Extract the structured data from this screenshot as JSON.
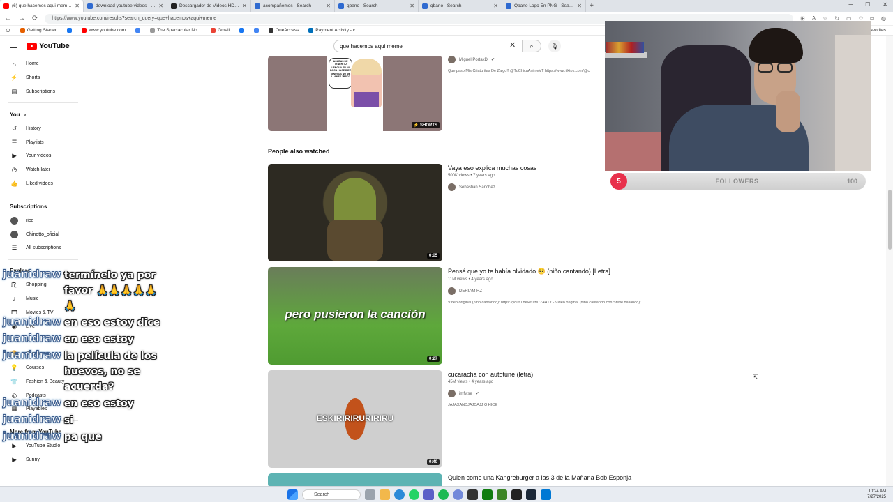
{
  "browser": {
    "tabs": [
      {
        "title": "(6) que hacemos aqui meme - Yo",
        "color": "#ff0000",
        "active": true
      },
      {
        "title": "download youtube videos - Search",
        "color": "#2f6ad0"
      },
      {
        "title": "Descargador de Videos HD de Yo",
        "color": "#222222"
      },
      {
        "title": "acompañemos - Search",
        "color": "#2f6ad0"
      },
      {
        "title": "qbano - Search",
        "color": "#2f6ad0"
      },
      {
        "title": "qbano - Search",
        "color": "#2f6ad0"
      },
      {
        "title": "Qbano Logo En PNG - Search Ima",
        "color": "#2f6ad0"
      }
    ],
    "new_tab": "+",
    "url": "https://www.youtube.com/results?search_query=que+hacemos+aqui+meme",
    "bookmarks": [
      {
        "label": "Getting Started",
        "color": "#e66000"
      },
      {
        "label": "",
        "color": "#1877f2"
      },
      {
        "label": "www.youtube.com",
        "color": "#ff0000"
      },
      {
        "label": "",
        "color": "#4285f4"
      },
      {
        "label": "The Spectacular No...",
        "color": "#999999"
      },
      {
        "label": "Gmail",
        "color": "#ea4335"
      },
      {
        "label": "",
        "color": "#1877f2"
      },
      {
        "label": "",
        "color": "#4285f4"
      },
      {
        "label": "OneAccess",
        "color": "#333333"
      },
      {
        "label": "Payment Activity - c...",
        "color": "#0070ba"
      }
    ],
    "favorites": "Favorites"
  },
  "youtube": {
    "logo": "YouTube",
    "search_query": "que hacemos aqui meme",
    "sidebar": {
      "main": [
        "Home",
        "Shorts",
        "Subscriptions"
      ],
      "you_label": "You",
      "you_items": [
        "History",
        "Playlists",
        "Your videos",
        "Watch later",
        "Liked videos"
      ],
      "subs_label": "Subscriptions",
      "subs_items": [
        "rice",
        "Chinotto_oficial",
        "All subscriptions"
      ],
      "explore_label": "Explore",
      "explore_items": [
        "Shopping",
        "Music",
        "Movies & TV",
        "Live",
        "News",
        "Sports",
        "Courses",
        "Fashion & Beauty",
        "Podcasts",
        "Playables"
      ],
      "more_label": "More from YouTube",
      "more_items": [
        "YouTube Studio",
        "Sunny"
      ]
    },
    "top_result": {
      "channel": "Miguel PortaxD",
      "desc": "Que paso Mis Criaturitas De Zaigo!! @TuChicaAnimeVT https://www.tiktok.com/@cl",
      "badge": "SHORTS",
      "panel_text": "ACABAS DE TENER TU LENGUA EN MI BOCA HACE DIEZ MINUTOS NO ME LLAMES \"BRO\""
    },
    "section_title": "People also watched",
    "videos": [
      {
        "title": "Vaya eso explica muchas cosas",
        "meta": "500K views • 7 years ago",
        "channel": "Sebastian Sanchez",
        "desc": "",
        "duration": "0:05",
        "thumb_text": ""
      },
      {
        "title": "Pensé que yo te había olvidado 🥺 (niño cantando) [Letra]",
        "meta": "11M views • 4 years ago",
        "channel": "DERIAM RZ",
        "desc": "Video original (niño cantando): https://youtu.be/4tufM7Z4H1Y - Video original (niño cantando con Steve bailando):",
        "duration": "0:27",
        "thumb_text": "pero pusieron la canción"
      },
      {
        "title": "cucaracha con autotune (letra)",
        "meta": "45M views • 4 years ago",
        "channel": "imfwse",
        "desc": "JAJAXANDJAJDAJJ Q HICE",
        "duration": "0:40",
        "thumb_text": "ESKIRIRIRURIRIRU"
      },
      {
        "title": "Quien come una Kangreburger a las 3 de la Mañana Bob Esponja",
        "meta": "",
        "channel": "",
        "desc": "",
        "duration": "",
        "thumb_text": ""
      }
    ]
  },
  "stream": {
    "followers_count": "5",
    "followers_label": "FOLLOWERS",
    "followers_goal": "100",
    "chat": [
      {
        "user": "juanidraw",
        "msg": "termínelo ya por favor 🙏🙏🙏🙏🙏🙏"
      },
      {
        "user": "juanidraw",
        "msg": "en eso estoy dice"
      },
      {
        "user": "juanidraw",
        "msg": "en eso estoy"
      },
      {
        "user": "juanidraw",
        "msg": "la película de los huevos, no se acuerda?"
      },
      {
        "user": "juanidraw",
        "msg": "en eso estoy"
      },
      {
        "user": "juanidraw",
        "msg": "si"
      },
      {
        "user": "juanidraw",
        "msg": "pa que"
      }
    ]
  },
  "taskbar": {
    "search_label": "Search",
    "time": "10:24 AM",
    "date": "7/27/2025"
  }
}
